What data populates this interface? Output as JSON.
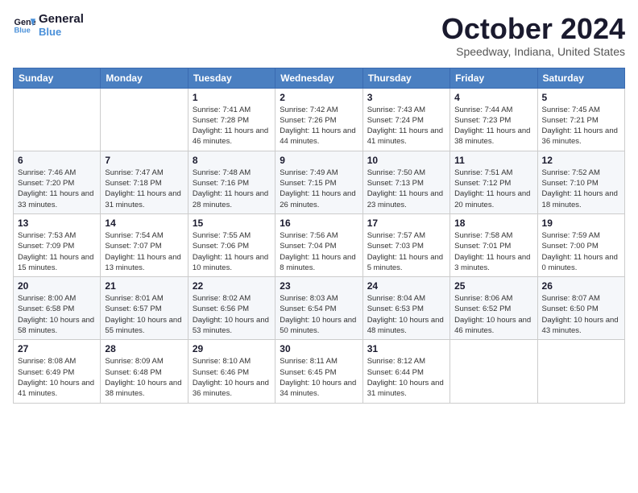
{
  "header": {
    "logo_line1": "General",
    "logo_line2": "Blue",
    "month_title": "October 2024",
    "location": "Speedway, Indiana, United States"
  },
  "days_of_week": [
    "Sunday",
    "Monday",
    "Tuesday",
    "Wednesday",
    "Thursday",
    "Friday",
    "Saturday"
  ],
  "weeks": [
    [
      {
        "day": "",
        "info": ""
      },
      {
        "day": "",
        "info": ""
      },
      {
        "day": "1",
        "info": "Sunrise: 7:41 AM\nSunset: 7:28 PM\nDaylight: 11 hours and 46 minutes."
      },
      {
        "day": "2",
        "info": "Sunrise: 7:42 AM\nSunset: 7:26 PM\nDaylight: 11 hours and 44 minutes."
      },
      {
        "day": "3",
        "info": "Sunrise: 7:43 AM\nSunset: 7:24 PM\nDaylight: 11 hours and 41 minutes."
      },
      {
        "day": "4",
        "info": "Sunrise: 7:44 AM\nSunset: 7:23 PM\nDaylight: 11 hours and 38 minutes."
      },
      {
        "day": "5",
        "info": "Sunrise: 7:45 AM\nSunset: 7:21 PM\nDaylight: 11 hours and 36 minutes."
      }
    ],
    [
      {
        "day": "6",
        "info": "Sunrise: 7:46 AM\nSunset: 7:20 PM\nDaylight: 11 hours and 33 minutes."
      },
      {
        "day": "7",
        "info": "Sunrise: 7:47 AM\nSunset: 7:18 PM\nDaylight: 11 hours and 31 minutes."
      },
      {
        "day": "8",
        "info": "Sunrise: 7:48 AM\nSunset: 7:16 PM\nDaylight: 11 hours and 28 minutes."
      },
      {
        "day": "9",
        "info": "Sunrise: 7:49 AM\nSunset: 7:15 PM\nDaylight: 11 hours and 26 minutes."
      },
      {
        "day": "10",
        "info": "Sunrise: 7:50 AM\nSunset: 7:13 PM\nDaylight: 11 hours and 23 minutes."
      },
      {
        "day": "11",
        "info": "Sunrise: 7:51 AM\nSunset: 7:12 PM\nDaylight: 11 hours and 20 minutes."
      },
      {
        "day": "12",
        "info": "Sunrise: 7:52 AM\nSunset: 7:10 PM\nDaylight: 11 hours and 18 minutes."
      }
    ],
    [
      {
        "day": "13",
        "info": "Sunrise: 7:53 AM\nSunset: 7:09 PM\nDaylight: 11 hours and 15 minutes."
      },
      {
        "day": "14",
        "info": "Sunrise: 7:54 AM\nSunset: 7:07 PM\nDaylight: 11 hours and 13 minutes."
      },
      {
        "day": "15",
        "info": "Sunrise: 7:55 AM\nSunset: 7:06 PM\nDaylight: 11 hours and 10 minutes."
      },
      {
        "day": "16",
        "info": "Sunrise: 7:56 AM\nSunset: 7:04 PM\nDaylight: 11 hours and 8 minutes."
      },
      {
        "day": "17",
        "info": "Sunrise: 7:57 AM\nSunset: 7:03 PM\nDaylight: 11 hours and 5 minutes."
      },
      {
        "day": "18",
        "info": "Sunrise: 7:58 AM\nSunset: 7:01 PM\nDaylight: 11 hours and 3 minutes."
      },
      {
        "day": "19",
        "info": "Sunrise: 7:59 AM\nSunset: 7:00 PM\nDaylight: 11 hours and 0 minutes."
      }
    ],
    [
      {
        "day": "20",
        "info": "Sunrise: 8:00 AM\nSunset: 6:58 PM\nDaylight: 10 hours and 58 minutes."
      },
      {
        "day": "21",
        "info": "Sunrise: 8:01 AM\nSunset: 6:57 PM\nDaylight: 10 hours and 55 minutes."
      },
      {
        "day": "22",
        "info": "Sunrise: 8:02 AM\nSunset: 6:56 PM\nDaylight: 10 hours and 53 minutes."
      },
      {
        "day": "23",
        "info": "Sunrise: 8:03 AM\nSunset: 6:54 PM\nDaylight: 10 hours and 50 minutes."
      },
      {
        "day": "24",
        "info": "Sunrise: 8:04 AM\nSunset: 6:53 PM\nDaylight: 10 hours and 48 minutes."
      },
      {
        "day": "25",
        "info": "Sunrise: 8:06 AM\nSunset: 6:52 PM\nDaylight: 10 hours and 46 minutes."
      },
      {
        "day": "26",
        "info": "Sunrise: 8:07 AM\nSunset: 6:50 PM\nDaylight: 10 hours and 43 minutes."
      }
    ],
    [
      {
        "day": "27",
        "info": "Sunrise: 8:08 AM\nSunset: 6:49 PM\nDaylight: 10 hours and 41 minutes."
      },
      {
        "day": "28",
        "info": "Sunrise: 8:09 AM\nSunset: 6:48 PM\nDaylight: 10 hours and 38 minutes."
      },
      {
        "day": "29",
        "info": "Sunrise: 8:10 AM\nSunset: 6:46 PM\nDaylight: 10 hours and 36 minutes."
      },
      {
        "day": "30",
        "info": "Sunrise: 8:11 AM\nSunset: 6:45 PM\nDaylight: 10 hours and 34 minutes."
      },
      {
        "day": "31",
        "info": "Sunrise: 8:12 AM\nSunset: 6:44 PM\nDaylight: 10 hours and 31 minutes."
      },
      {
        "day": "",
        "info": ""
      },
      {
        "day": "",
        "info": ""
      }
    ]
  ]
}
